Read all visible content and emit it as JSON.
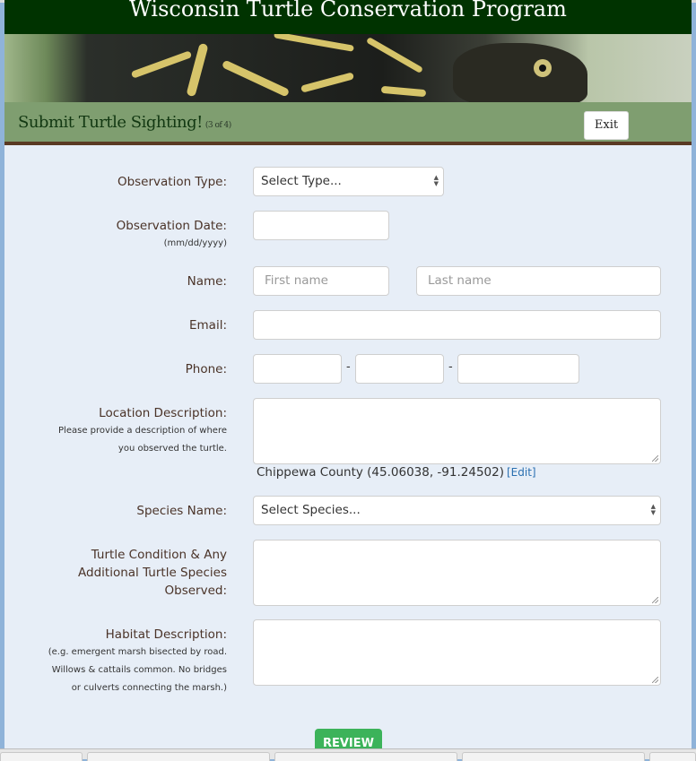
{
  "header": {
    "title": "Wisconsin Turtle Conservation Program"
  },
  "banner": {
    "image_alt": "turtle-photo"
  },
  "subheader": {
    "title": "Submit Turtle Sighting!",
    "step": "(3 of 4)",
    "exit_label": "Exit"
  },
  "form": {
    "observation_type": {
      "label": "Observation Type:",
      "selected": "Select Type..."
    },
    "observation_date": {
      "label": "Observation Date:",
      "hint": "(mm/dd/yyyy)",
      "value": ""
    },
    "name": {
      "label": "Name:",
      "first_placeholder": "First name",
      "last_placeholder": "Last name"
    },
    "email": {
      "label": "Email:",
      "value": ""
    },
    "phone": {
      "label": "Phone:",
      "separator": "-"
    },
    "location": {
      "label": "Location Description:",
      "hint_line1": "Please provide a description of where",
      "hint_line2": "you observed the turtle.",
      "value": "",
      "county": "Chippewa County (45.06038, -91.24502)",
      "edit_label": "[Edit]"
    },
    "species": {
      "label": "Species Name:",
      "selected": "Select Species..."
    },
    "condition": {
      "label_line1": "Turtle Condition & Any",
      "label_line2": "Additional Turtle Species",
      "label_line3": "Observed:"
    },
    "habitat": {
      "label": "Habitat Description:",
      "hint_line1": "(e.g. emergent marsh bisected by road.",
      "hint_line2": "Willows & cattails common. No bridges",
      "hint_line3": "or culverts connecting the marsh.)"
    },
    "review_label": "REVIEW"
  },
  "colors": {
    "header_bg": "#003300",
    "subheader_bg": "#7f9e70",
    "divider": "#5a3a24",
    "form_bg": "#e7eef7",
    "review_btn": "#3cb35a",
    "label_text": "#4a3328",
    "link": "#2a6fb0"
  }
}
